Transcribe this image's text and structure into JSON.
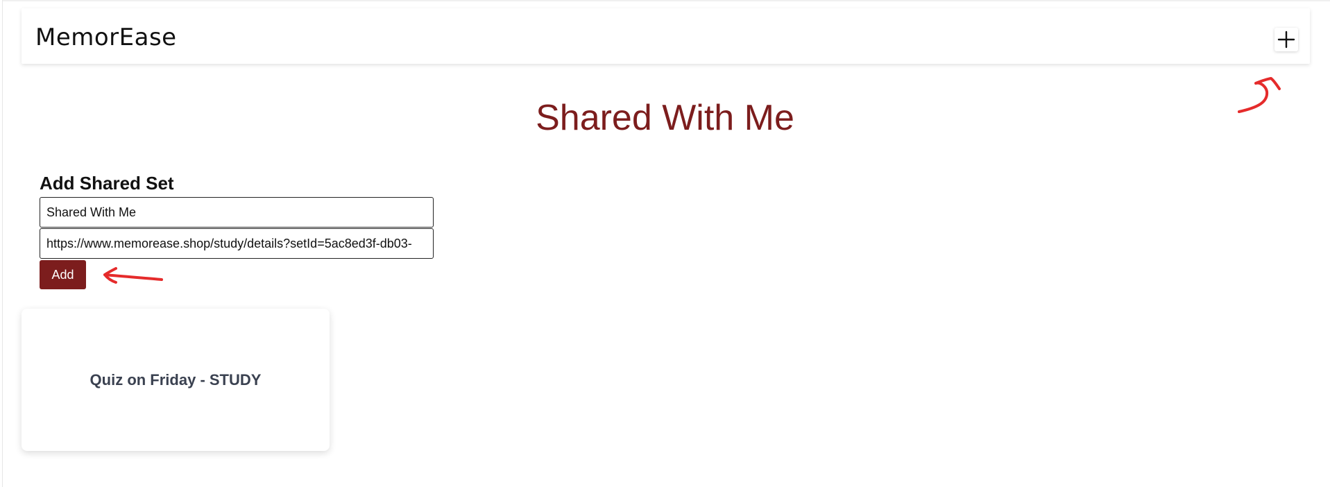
{
  "navbar": {
    "brand": "MemorEase",
    "add_icon": "plus-icon"
  },
  "page": {
    "title": "Shared With Me"
  },
  "add_shared_set": {
    "heading": "Add Shared Set",
    "name_value": "Shared With Me",
    "link_value": "https://www.memorease.shop/study/details?setId=5ac8ed3f-db03-",
    "add_label": "Add"
  },
  "sets": [
    {
      "title": "Quiz on Friday - STUDY"
    }
  ],
  "annotations": {
    "color": "#e52b2b",
    "items": [
      "arrow-to-plus-button",
      "arrow-to-add-button"
    ]
  },
  "colors": {
    "brand_red": "#7c1d1d",
    "card_text": "#3a4150"
  }
}
